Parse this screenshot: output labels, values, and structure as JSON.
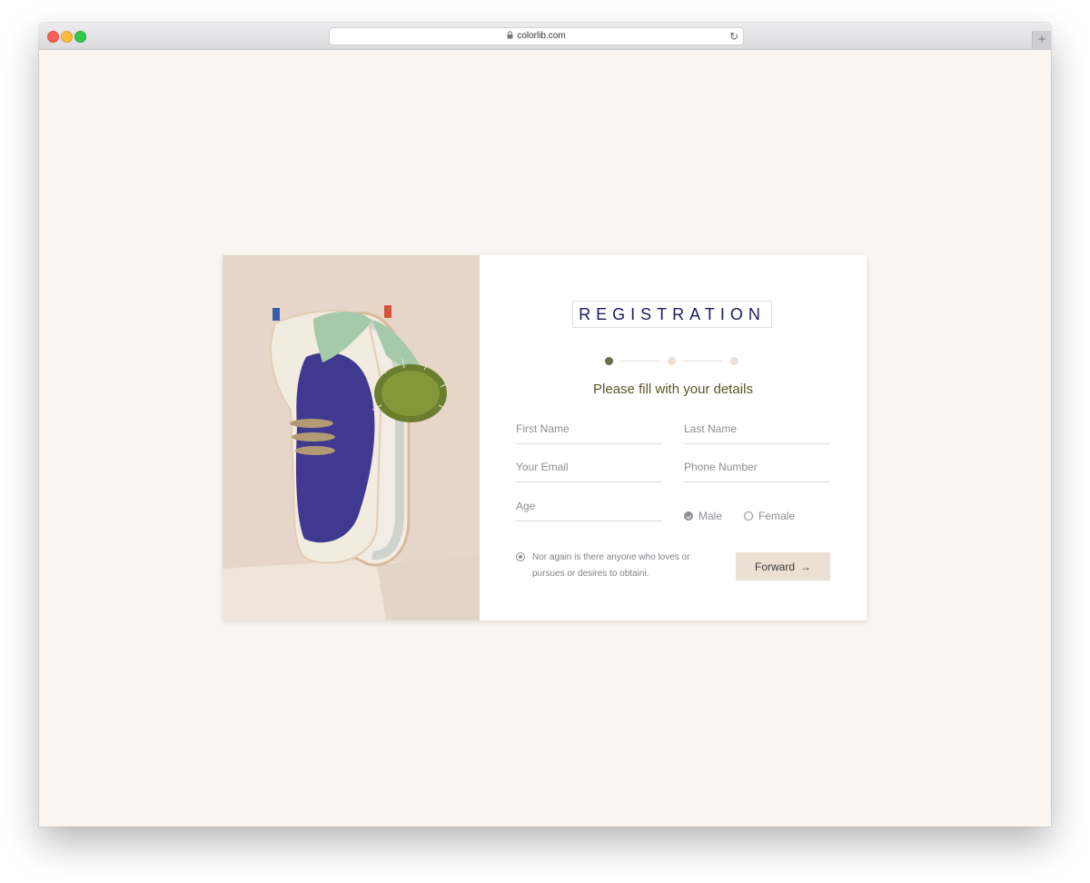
{
  "browser": {
    "url": "colorlib.com",
    "lock_icon": "lock-icon",
    "reload_icon": "reload-icon",
    "new_tab_label": "+"
  },
  "registration": {
    "title": "REGISTRATION",
    "subtitle": "Please fill with your details",
    "steps": {
      "total": 3,
      "active": 1
    },
    "fields": {
      "first_name": {
        "placeholder": "First Name",
        "value": ""
      },
      "last_name": {
        "placeholder": "Last Name",
        "value": ""
      },
      "email": {
        "placeholder": "Your Email",
        "value": ""
      },
      "phone": {
        "placeholder": "Phone Number",
        "value": ""
      },
      "age": {
        "placeholder": "Age",
        "value": ""
      }
    },
    "gender": {
      "options": [
        "Male",
        "Female"
      ],
      "selected": "Male"
    },
    "agreement_text": "Nor again is there anyone who loves or pursues or desires to obtaini.",
    "forward_label": "Forward",
    "forward_arrow": "→"
  },
  "colors": {
    "page_background": "#faf5f0",
    "title_text": "#1c1a5e",
    "subtitle_text": "#5b5628",
    "active_step": "#6a6d49",
    "inactive_step": "#ecdfd3",
    "button_background": "#ecdfd3"
  }
}
